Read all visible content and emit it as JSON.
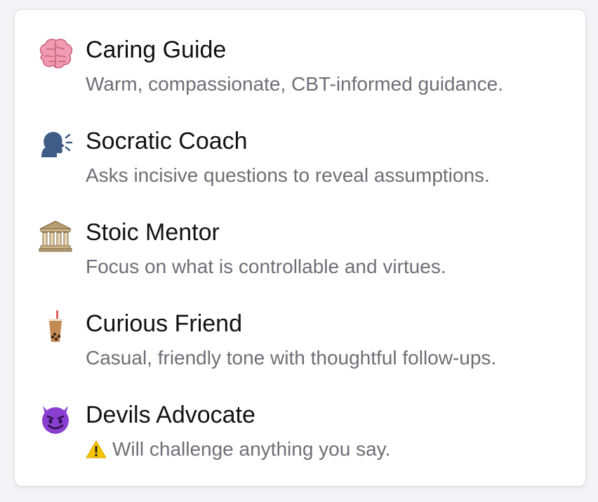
{
  "personas": [
    {
      "icon": "brain-icon",
      "title": "Caring Guide",
      "description": "Warm, compassionate, CBT-informed guidance."
    },
    {
      "icon": "speaking-head-icon",
      "title": "Socratic Coach",
      "description": "Asks incisive questions to reveal assumptions."
    },
    {
      "icon": "classical-building-icon",
      "title": "Stoic Mentor",
      "description": "Focus on what is controllable and virtues."
    },
    {
      "icon": "bubble-tea-icon",
      "title": "Curious Friend",
      "description": "Casual, friendly tone with thoughtful follow-ups."
    },
    {
      "icon": "smiling-devil-icon",
      "title": "Devils Advocate",
      "description": "Will challenge anything you say.",
      "description_prefix_icon": "warning-icon"
    }
  ],
  "colors": {
    "title": "#111114",
    "description": "#6e6e76",
    "card_border": "#dcdce0",
    "devil": "#8a3fd1",
    "warning": "#f5c400"
  }
}
